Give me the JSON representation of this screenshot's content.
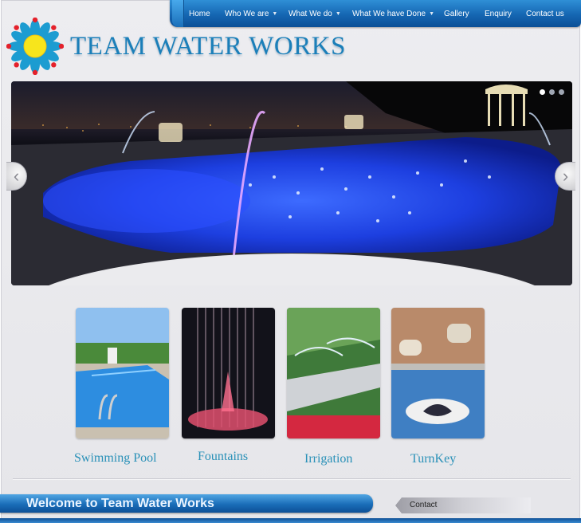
{
  "brand": {
    "name": "TEAM WATER WORKS",
    "logo_icon": "sunflower-logo-icon",
    "accent_color": "#1b7fb9",
    "sun_color": "#f7e51c",
    "petal_color": "#1c9cd1",
    "dot_color": "#e4212b"
  },
  "nav": {
    "items": [
      {
        "label": "Home",
        "dropdown": false
      },
      {
        "label": "Who We are",
        "dropdown": true
      },
      {
        "label": "What We do",
        "dropdown": true
      },
      {
        "label": "What We have Done",
        "dropdown": true
      },
      {
        "label": "Gallery",
        "dropdown": false
      },
      {
        "label": "Enquiry",
        "dropdown": false
      },
      {
        "label": "Contact us",
        "dropdown": false
      }
    ],
    "caret": "▼"
  },
  "slider": {
    "dots": 3,
    "active_dot": 1,
    "prev_arrow": "‹",
    "next_arrow": "›"
  },
  "services": [
    {
      "label": "Swimming Pool"
    },
    {
      "label": "Fountains"
    },
    {
      "label": "Irrigation"
    },
    {
      "label": "TurnKey"
    }
  ],
  "welcome": {
    "title": "Welcome to Team Water Works"
  },
  "contact_tab": {
    "label": "Contact"
  }
}
